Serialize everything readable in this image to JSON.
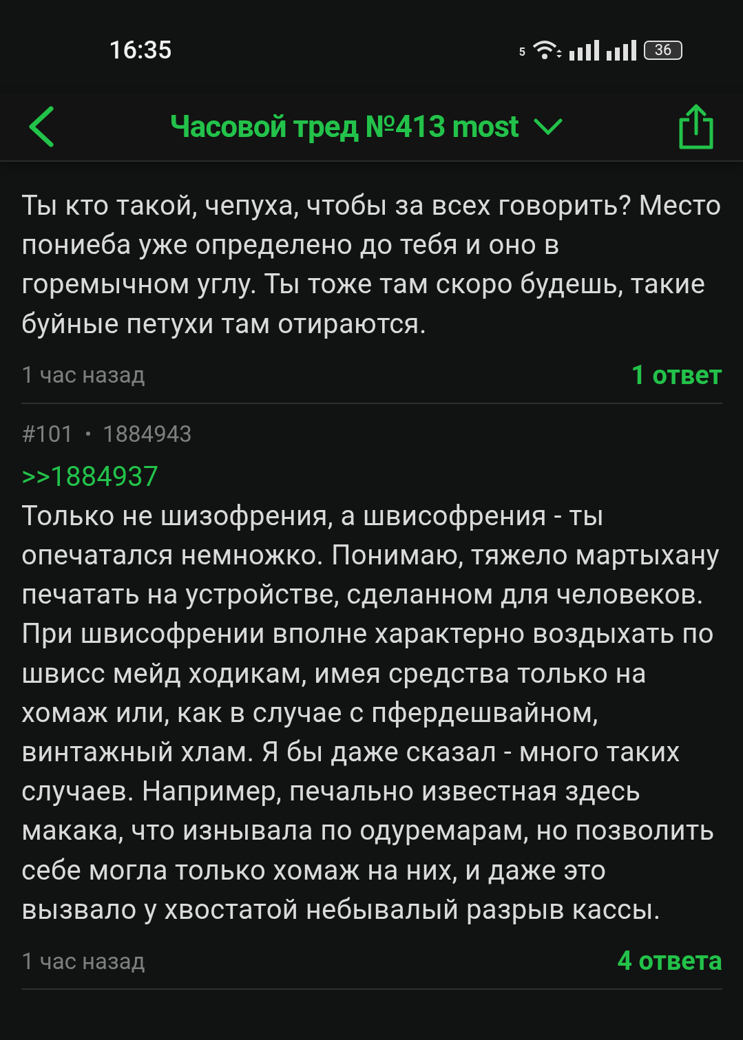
{
  "status_bar": {
    "time": "16:35",
    "wifi_band": "5",
    "battery": "36"
  },
  "header": {
    "title": "Часовой тред №413 most"
  },
  "posts": [
    {
      "body": "Ты кто такой, чепуха, чтобы за всех говорить? Место пониеба уже определено до тебя и оно в горемычном углу. Ты тоже там скоро будешь, такие буйные петухи там отираются.",
      "time": "1 час назад",
      "replies": "1 ответ"
    },
    {
      "number": "#101",
      "id": "1884943",
      "reply_link": ">>1884937",
      "body": "Только не шизофрения, а швисофрения - ты опечатался немножко. Понимаю, тяжело мартыхану печатать на устройстве, сделанном для человеков. При швисофрении вполне характерно воздыхать по швисс мейд ходикам, имея средства только на хомаж или, как в случае с пфердешвайном, винтажный хлам. Я бы даже сказал - много таких случаев. Например, печально известная здесь макака, что изнывала по одуремарам, но позволить себе могла только хомаж на них, и даже это вызвало у хвостатой небывалый разрыв кассы.",
      "time": "1 час назад",
      "replies": "4 ответа"
    }
  ]
}
